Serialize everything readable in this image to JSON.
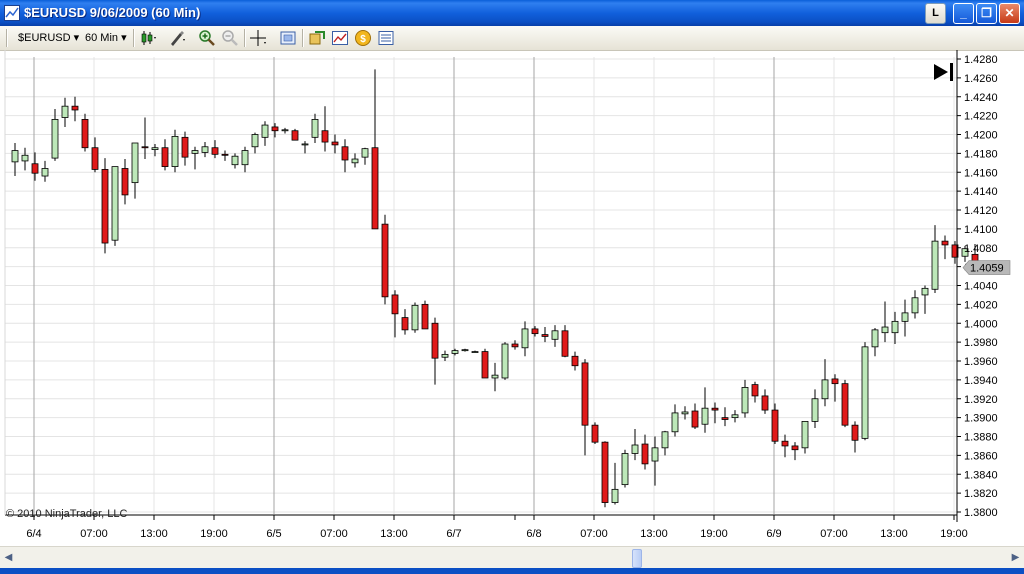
{
  "window": {
    "title": "$EURUSD  9/06/2009 (60 Min)",
    "btn_l": "L",
    "btn_min": "_",
    "btn_max": "❐",
    "btn_close": "✕"
  },
  "toolbar": {
    "instrument": "$EURUSD",
    "period": "60 Min"
  },
  "chart": {
    "copyright": "© 2010 NinjaTrader, LLC",
    "last_price_label": "1.4059",
    "last_price": 1.4059,
    "y_labels": [
      "1.4280",
      "1.4260",
      "1.4240",
      "1.4220",
      "1.4200",
      "1.4180",
      "1.4160",
      "1.4140",
      "1.4120",
      "1.4100",
      "1.4080",
      "1.4060",
      "1.4040",
      "1.4020",
      "1.4000",
      "1.3980",
      "1.3960",
      "1.3940",
      "1.3920",
      "1.3900",
      "1.3880",
      "1.3860",
      "1.3840",
      "1.3820",
      "1.3800"
    ],
    "x_labels": [
      "6/4",
      "07:00",
      "13:00",
      "19:00",
      "6/5",
      "07:00",
      "13:00",
      "6/7",
      "6/8",
      "07:00",
      "13:00",
      "19:00",
      "6/9",
      "07:00",
      "13:00",
      "19:00"
    ],
    "colors": {
      "up": "#bde8b9",
      "down": "#e01a1a",
      "wick": "#000000",
      "grid": "#e4e4e4",
      "session_line": "#a6a6a6",
      "price_tag": "#b8b8b8"
    }
  },
  "chart_data": {
    "type": "candlestick",
    "symbol": "$EURUSD",
    "interval": "60 Min",
    "ylim": [
      1.428,
      1.38
    ],
    "ohlc": [
      [
        1.4171,
        1.4191,
        1.4156,
        1.4183
      ],
      [
        1.4172,
        1.4186,
        1.4162,
        1.4178
      ],
      [
        1.4169,
        1.4181,
        1.4151,
        1.4159
      ],
      [
        1.4156,
        1.4172,
        1.415,
        1.4164
      ],
      [
        1.4175,
        1.4227,
        1.4172,
        1.4216
      ],
      [
        1.4218,
        1.4239,
        1.4208,
        1.423
      ],
      [
        1.423,
        1.424,
        1.4214,
        1.4226
      ],
      [
        1.4216,
        1.4222,
        1.4182,
        1.4186
      ],
      [
        1.4186,
        1.4197,
        1.416,
        1.4163
      ],
      [
        1.4163,
        1.4175,
        1.4074,
        1.4085
      ],
      [
        1.4088,
        1.4165,
        1.4082,
        1.4166
      ],
      [
        1.4164,
        1.4174,
        1.4126,
        1.4136
      ],
      [
        1.4149,
        1.419,
        1.4132,
        1.4191
      ],
      [
        1.4187,
        1.4218,
        1.4174,
        1.4186
      ],
      [
        1.4184,
        1.419,
        1.4177,
        1.4186
      ],
      [
        1.4186,
        1.4195,
        1.4162,
        1.4166
      ],
      [
        1.4166,
        1.4205,
        1.416,
        1.4198
      ],
      [
        1.4197,
        1.4203,
        1.4167,
        1.4176
      ],
      [
        1.418,
        1.4187,
        1.4163,
        1.4183
      ],
      [
        1.4181,
        1.4192,
        1.4176,
        1.4187
      ],
      [
        1.4186,
        1.4194,
        1.4175,
        1.4179
      ],
      [
        1.4179,
        1.4183,
        1.4172,
        1.4178
      ],
      [
        1.4168,
        1.418,
        1.4164,
        1.4177
      ],
      [
        1.4168,
        1.4187,
        1.416,
        1.4183
      ],
      [
        1.4187,
        1.4202,
        1.418,
        1.42
      ],
      [
        1.4197,
        1.4214,
        1.4188,
        1.421
      ],
      [
        1.4208,
        1.4212,
        1.4197,
        1.4204
      ],
      [
        1.4204,
        1.4207,
        1.4201,
        1.4205
      ],
      [
        1.4204,
        1.4206,
        1.4195,
        1.4194
      ],
      [
        1.419,
        1.4193,
        1.418,
        1.419
      ],
      [
        1.4197,
        1.4222,
        1.4191,
        1.4216
      ],
      [
        1.4204,
        1.423,
        1.4182,
        1.4192
      ],
      [
        1.4192,
        1.42,
        1.418,
        1.4189
      ],
      [
        1.4187,
        1.4195,
        1.416,
        1.4173
      ],
      [
        1.417,
        1.418,
        1.4165,
        1.4174
      ],
      [
        1.4176,
        1.4186,
        1.4168,
        1.4185
      ],
      [
        1.4186,
        1.4269,
        1.418,
        1.41
      ],
      [
        1.4105,
        1.4115,
        1.402,
        1.4028
      ],
      [
        1.403,
        1.4035,
        1.3985,
        1.401
      ],
      [
        1.4006,
        1.4015,
        1.3988,
        1.3993
      ],
      [
        1.3993,
        1.4022,
        1.399,
        1.4019
      ],
      [
        1.402,
        1.4024,
        1.3997,
        1.3994
      ],
      [
        1.4,
        1.4006,
        1.3935,
        1.3963
      ],
      [
        1.3964,
        1.3971,
        1.396,
        1.3967
      ],
      [
        1.3968,
        1.3973,
        1.3966,
        1.3971
      ],
      [
        1.3971,
        1.3973,
        1.397,
        1.3972
      ],
      [
        1.397,
        1.3971,
        1.397,
        1.397
      ],
      [
        1.397,
        1.3973,
        1.3942,
        1.3942
      ],
      [
        1.3942,
        1.3958,
        1.3928,
        1.3945
      ],
      [
        1.3942,
        1.398,
        1.394,
        1.3978
      ],
      [
        1.3978,
        1.3982,
        1.3972,
        1.3975
      ],
      [
        1.3974,
        1.4002,
        1.3965,
        1.3994
      ],
      [
        1.3994,
        1.3997,
        1.3986,
        1.3989
      ],
      [
        1.3988,
        1.3996,
        1.398,
        1.3986
      ],
      [
        1.3983,
        1.3998,
        1.3975,
        1.3992
      ],
      [
        1.3992,
        1.3998,
        1.3964,
        1.3965
      ],
      [
        1.3965,
        1.397,
        1.395,
        1.3955
      ],
      [
        1.3958,
        1.3962,
        1.386,
        1.3892
      ],
      [
        1.3892,
        1.3895,
        1.3872,
        1.3874
      ],
      [
        1.3874,
        1.3875,
        1.3805,
        1.381
      ],
      [
        1.381,
        1.3852,
        1.3808,
        1.3824
      ],
      [
        1.3829,
        1.3866,
        1.3826,
        1.3862
      ],
      [
        1.3862,
        1.3888,
        1.3855,
        1.3871
      ],
      [
        1.3872,
        1.3882,
        1.3845,
        1.3851
      ],
      [
        1.3854,
        1.388,
        1.3828,
        1.3868
      ],
      [
        1.3868,
        1.3886,
        1.386,
        1.3885
      ],
      [
        1.3885,
        1.3914,
        1.388,
        1.3905
      ],
      [
        1.3904,
        1.3912,
        1.3898,
        1.3906
      ],
      [
        1.3907,
        1.3915,
        1.3888,
        1.389
      ],
      [
        1.3893,
        1.3932,
        1.3884,
        1.391
      ],
      [
        1.391,
        1.3916,
        1.3894,
        1.3908
      ],
      [
        1.39,
        1.3911,
        1.3891,
        1.3898
      ],
      [
        1.39,
        1.3908,
        1.3895,
        1.3903
      ],
      [
        1.3905,
        1.394,
        1.39,
        1.3932
      ],
      [
        1.3935,
        1.3938,
        1.3916,
        1.3923
      ],
      [
        1.3923,
        1.393,
        1.3904,
        1.3908
      ],
      [
        1.3908,
        1.3915,
        1.3872,
        1.3875
      ],
      [
        1.3875,
        1.3882,
        1.3858,
        1.387
      ],
      [
        1.387,
        1.3874,
        1.3855,
        1.3866
      ],
      [
        1.3868,
        1.3896,
        1.3862,
        1.3896
      ],
      [
        1.3896,
        1.393,
        1.3889,
        1.392
      ],
      [
        1.392,
        1.3962,
        1.3912,
        1.394
      ],
      [
        1.3941,
        1.3946,
        1.3917,
        1.3936
      ],
      [
        1.3936,
        1.394,
        1.389,
        1.3892
      ],
      [
        1.3892,
        1.3896,
        1.3863,
        1.3876
      ],
      [
        1.3878,
        1.398,
        1.3876,
        1.3975
      ],
      [
        1.3975,
        1.3995,
        1.3965,
        1.3993
      ],
      [
        1.399,
        1.4023,
        1.398,
        1.3996
      ],
      [
        1.399,
        1.4012,
        1.3978,
        1.4002
      ],
      [
        1.4002,
        1.4025,
        1.3986,
        1.4011
      ],
      [
        1.4011,
        1.4035,
        1.4005,
        1.4027
      ],
      [
        1.403,
        1.404,
        1.401,
        1.4037
      ],
      [
        1.4036,
        1.4104,
        1.4032,
        1.4087
      ],
      [
        1.4087,
        1.4093,
        1.4068,
        1.4083
      ],
      [
        1.4083,
        1.4087,
        1.4063,
        1.407
      ],
      [
        1.4071,
        1.4082,
        1.4065,
        1.4079
      ],
      [
        1.4073,
        1.4084,
        1.4055,
        1.4059
      ]
    ]
  }
}
